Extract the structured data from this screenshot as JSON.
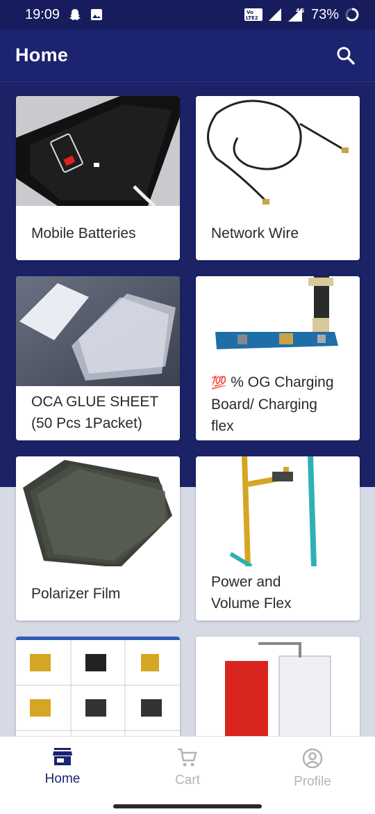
{
  "status_bar": {
    "time": "19:09",
    "battery": "73%",
    "left_icons": [
      "snapchat-icon",
      "image-icon"
    ],
    "right_icons": [
      "volte-icon",
      "signal-icon",
      "4g-signal-icon",
      "battery-ring-icon"
    ]
  },
  "app_bar": {
    "title": "Home",
    "search_icon": "search-icon"
  },
  "categories": [
    {
      "label": "Mobile Batteries",
      "image": "phone-low-battery-image"
    },
    {
      "label": "Network Wire",
      "image": "coaxial-wire-image"
    },
    {
      "label_lines": [
        "OCA GLUE SHEET",
        "(50 Pcs 1Packet)"
      ],
      "image": "oca-sheets-image"
    },
    {
      "label_emoji": "💯",
      "label_lines": [
        "% OG Charging",
        "Board/ Charging",
        "flex"
      ],
      "image": "charging-board-image"
    },
    {
      "label": "Polarizer Film",
      "image": "polarizer-film-image"
    },
    {
      "label_lines": [
        "Power and",
        "Volume Flex"
      ],
      "image": "power-volume-flex-image"
    },
    {
      "image": "buttons-catalog-image"
    },
    {
      "image": "lcd-backlight-image"
    }
  ],
  "bottom_nav": {
    "items": [
      {
        "label": "Home",
        "icon": "store-icon",
        "active": true
      },
      {
        "label": "Cart",
        "icon": "cart-icon",
        "active": false
      },
      {
        "label": "Profile",
        "icon": "account-icon",
        "active": false
      }
    ]
  },
  "colors": {
    "primary": "#1c2370",
    "status_bar": "#171d5c",
    "background_lower": "#d5dae5",
    "inactive": "#b4b4b4"
  }
}
